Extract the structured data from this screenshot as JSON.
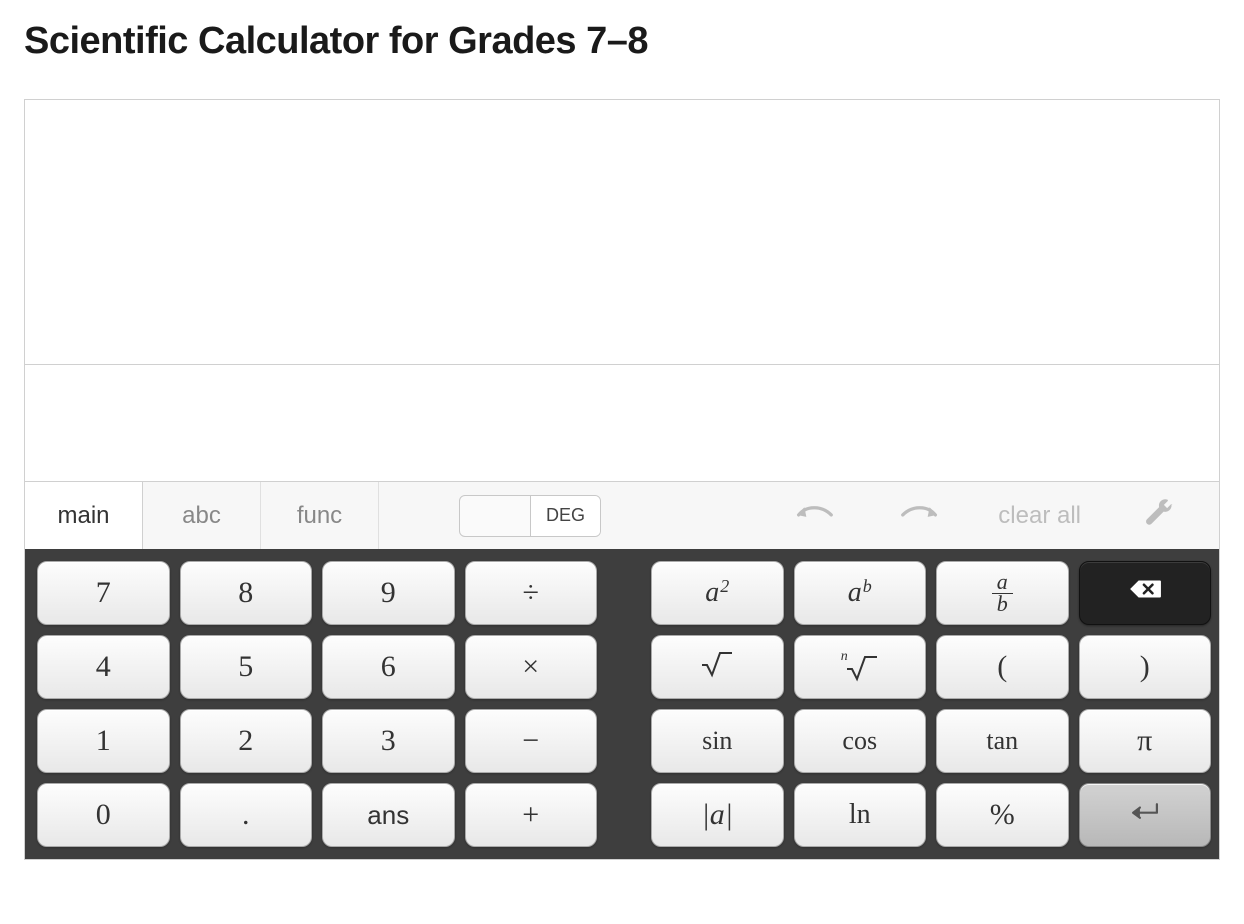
{
  "title": "Scientific Calculator for Grades 7–8",
  "toolbar": {
    "tabs": [
      {
        "id": "main",
        "label": "main",
        "active": true
      },
      {
        "id": "abc",
        "label": "abc",
        "active": false
      },
      {
        "id": "func",
        "label": "func",
        "active": false
      }
    ],
    "angle_mode": {
      "blank": "",
      "selected": "DEG"
    },
    "clear_all": "clear all"
  },
  "keys": {
    "n7": "7",
    "n8": "8",
    "n9": "9",
    "div": "÷",
    "n4": "4",
    "n5": "5",
    "n6": "6",
    "mul": "×",
    "n1": "1",
    "n2": "2",
    "n3": "3",
    "sub": "−",
    "n0": "0",
    "dot": ".",
    "ans": "ans",
    "add": "+",
    "sq_base": "a",
    "sq_exp": "2",
    "pow_base": "a",
    "pow_exp": "b",
    "frac_num": "a",
    "frac_den": "b",
    "sqrt": "√",
    "nroot_n": "n",
    "nroot_sym": "√",
    "lparen": "(",
    "rparen": ")",
    "sin": "sin",
    "cos": "cos",
    "tan": "tan",
    "pi": "π",
    "abs": "|a|",
    "ln": "ln",
    "percent": "%"
  }
}
